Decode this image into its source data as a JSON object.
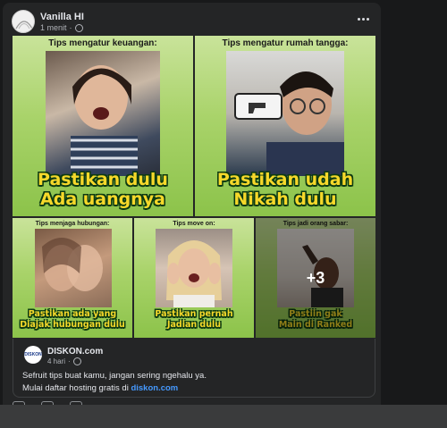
{
  "post": {
    "author": "Vanilla HI",
    "time": "1 menit",
    "dot": "·"
  },
  "tiles": [
    {
      "caption": "Tips mengatur keuangan:",
      "slogan_1": "Pastikan dulu",
      "slogan_2": "Ada uangnya"
    },
    {
      "caption": "Tips mengatur rumah tangga:",
      "slogan_1": "Pastikan udah",
      "slogan_2": "Nikah dulu"
    },
    {
      "caption": "Tips menjaga hubungan:",
      "slogan_1": "Pastikan ada yang",
      "slogan_2": "Diajak hubungan dulu"
    },
    {
      "caption": "Tips move on:",
      "slogan_1": "Pastikan pernah",
      "slogan_2": "Jadian dulu"
    },
    {
      "caption": "Tips jadi orang sabar:",
      "slogan_1": "Pastiin gak",
      "slogan_2": "Main di Ranked"
    }
  ],
  "more_count": "+3",
  "shared": {
    "logo_text": "DISKON",
    "name": "DISKON.com",
    "time": "4 hari",
    "dot": "·",
    "line1": "Sefruit tips buat kamu, jangan sering ngehalu ya.",
    "line2": "Mulai daftar hosting gratis di",
    "link": "diskon.com"
  },
  "colors": {
    "link": "#4599ff",
    "slogan": "#f6d82a",
    "tile_green": "#a9d36a"
  }
}
